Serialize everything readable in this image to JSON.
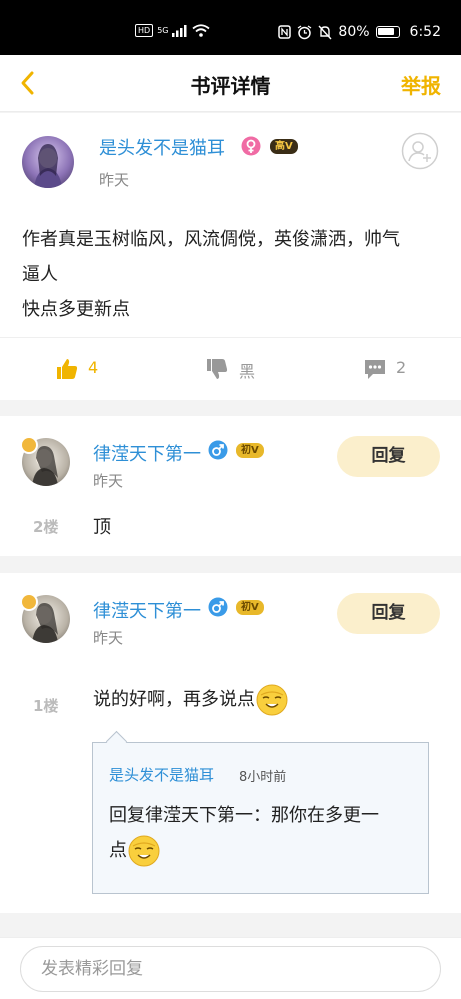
{
  "status_bar": {
    "hd": "HD",
    "network": "5G",
    "battery": "80%",
    "time": "6:52"
  },
  "nav": {
    "title": "书评详情",
    "report": "举报"
  },
  "post": {
    "author": "是头发不是猫耳",
    "badge": "高V",
    "time": "昨天",
    "content_line1": "作者真是玉树临风，风流倜傥，英俊潇洒，帅气",
    "content_line2": "逼人",
    "content_line3": "快点多更新点",
    "likes": "4",
    "dislike_label": "黑",
    "comments": "2"
  },
  "replies": [
    {
      "author": "律滢天下第一",
      "badge": "初V",
      "time": "昨天",
      "floor": "2楼",
      "text": "顶",
      "reply_label": "回复"
    },
    {
      "author": "律滢天下第一",
      "badge": "初V",
      "time": "昨天",
      "floor": "1楼",
      "text": "说的好啊，再多说点",
      "reply_label": "回复",
      "quote": {
        "author": "是头发不是猫耳",
        "time": "8小时前",
        "text_line1": "回复律滢天下第一：那你在多更一",
        "text_line2": "点"
      }
    }
  ],
  "composer": {
    "placeholder": "发表精彩回复"
  },
  "colors": {
    "accent": "#f0b400",
    "username": "#2e8fd6",
    "reply_button_bg": "#fbefcc"
  },
  "icons": {
    "back": "chevron-left-icon",
    "female": "female-icon",
    "male": "male-icon",
    "follow": "add-user-icon",
    "like": "thumbs-up-icon",
    "dislike": "thumbs-down-icon",
    "comment": "comment-icon",
    "emoji": "grinning-face-icon"
  }
}
